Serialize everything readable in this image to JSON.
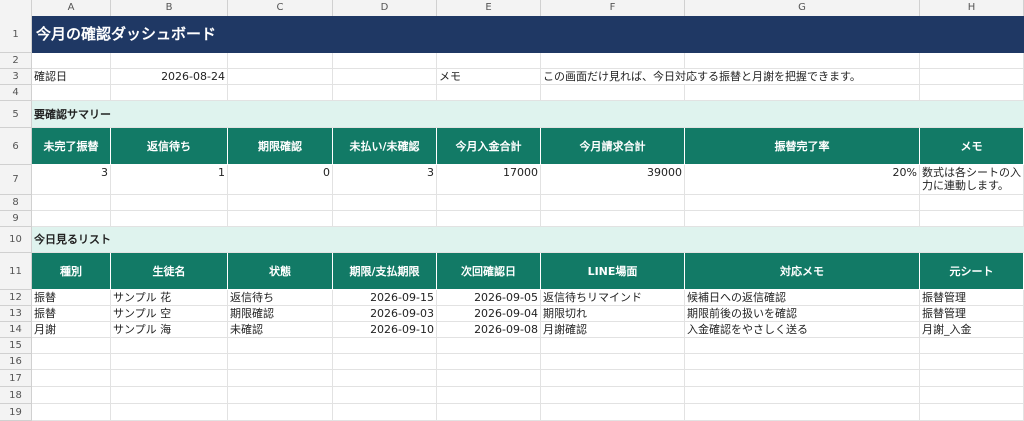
{
  "columns": [
    "A",
    "B",
    "C",
    "D",
    "E",
    "F",
    "G",
    "H"
  ],
  "row_numbers": [
    "1",
    "2",
    "3",
    "4",
    "5",
    "6",
    "7",
    "8",
    "9",
    "10",
    "11",
    "12",
    "13",
    "14",
    "15",
    "16",
    "17",
    "18",
    "19"
  ],
  "title": "今月の確認ダッシュボード",
  "info": {
    "check_date_label": "確認日",
    "check_date_value": "2026-08-24",
    "memo_label": "メモ",
    "memo_text": "この画面だけ見れば、今日対応する振替と月謝を把握できます。"
  },
  "summary": {
    "section_title": "要確認サマリー",
    "headers": [
      "未完了振替",
      "返信待ち",
      "期限確認",
      "未払い/未確認",
      "今月入金合計",
      "今月請求合計",
      "振替完了率",
      "メモ"
    ],
    "values": [
      "3",
      "1",
      "0",
      "3",
      "17000",
      "39000",
      "20%",
      "数式は各シートの入力に連動します。"
    ]
  },
  "today_list": {
    "section_title": "今日見るリスト",
    "headers": [
      "種別",
      "生徒名",
      "状態",
      "期限/支払期限",
      "次回確認日",
      "LINE場面",
      "対応メモ",
      "元シート"
    ],
    "rows": [
      [
        "振替",
        "サンプル 花",
        "返信待ち",
        "2026-09-15",
        "2026-09-05",
        "返信待ちリマインド",
        "候補日への返信確認",
        "振替管理"
      ],
      [
        "振替",
        "サンプル 空",
        "期限確認",
        "2026-09-03",
        "2026-09-04",
        "期限切れ",
        "期限前後の扱いを確認",
        "振替管理"
      ],
      [
        "月謝",
        "サンプル 海",
        "未確認",
        "2026-09-10",
        "2026-09-08",
        "月謝確認",
        "入金確認をやさしく送る",
        "月謝_入金"
      ]
    ]
  }
}
